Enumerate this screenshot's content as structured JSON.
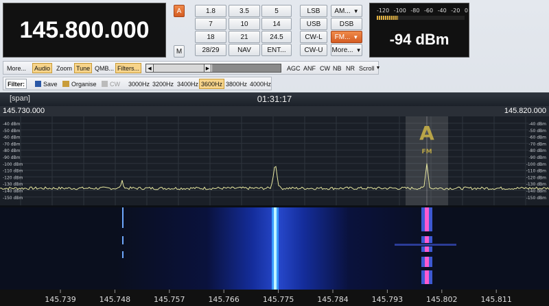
{
  "frequency": "145.800.000",
  "smeter": {
    "scale": [
      "-120",
      "-100",
      "-80",
      "-60",
      "-40",
      "-20",
      "0"
    ],
    "reading": "-94 dBm",
    "level_fraction": 0.24
  },
  "buttons": {
    "a": "A",
    "m": "M",
    "bands": [
      "1.8",
      "3.5",
      "5",
      "7",
      "10",
      "14",
      "18",
      "21",
      "24.5",
      "28/29",
      "NAV",
      "ENT..."
    ],
    "modes": [
      "LSB",
      "AM...",
      "USB",
      "DSB",
      "CW-L",
      "FM...",
      "CW-U",
      "More..."
    ]
  },
  "toolbar1": {
    "items": [
      "More...",
      "Audio",
      "Zoom",
      "Tune",
      "QMB...",
      "Filters...",
      "AGC",
      "ANF",
      "CW",
      "NB",
      "NR",
      "Scroll"
    ]
  },
  "toolbar2": {
    "filter_label": "Filter:",
    "save": "Save",
    "organise": "Organise",
    "cw": "CW",
    "widths": [
      "3000Hz",
      "3200Hz",
      "3400Hz",
      "3600Hz",
      "3800Hz",
      "4000Hz"
    ]
  },
  "spectrum": {
    "span_label": "[span]",
    "time": "01:31:17",
    "range_start": "145.730.000",
    "range_end": "145.820.000",
    "db_labels": [
      "-40 dBm",
      "-50 dBm",
      "-60 dBm",
      "-70 dBm",
      "-80 dBm",
      "-90 dBm",
      "-100 dBm",
      "-110 dBm",
      "-120 dBm",
      "-130 dBm",
      "-140 dBm",
      "-150 dBm"
    ],
    "marker_letter": "A",
    "marker_mode": "FM",
    "freq_axis": [
      "145.739",
      "145.748",
      "145.757",
      "145.766",
      "145.775",
      "145.784",
      "145.793",
      "145.802",
      "145.811"
    ]
  },
  "colors": {
    "accent_orange": "#d45c22",
    "highlight": "#f7d48a",
    "trace": "#e8e8a0",
    "waterfall_base": "#0a1a6a"
  }
}
